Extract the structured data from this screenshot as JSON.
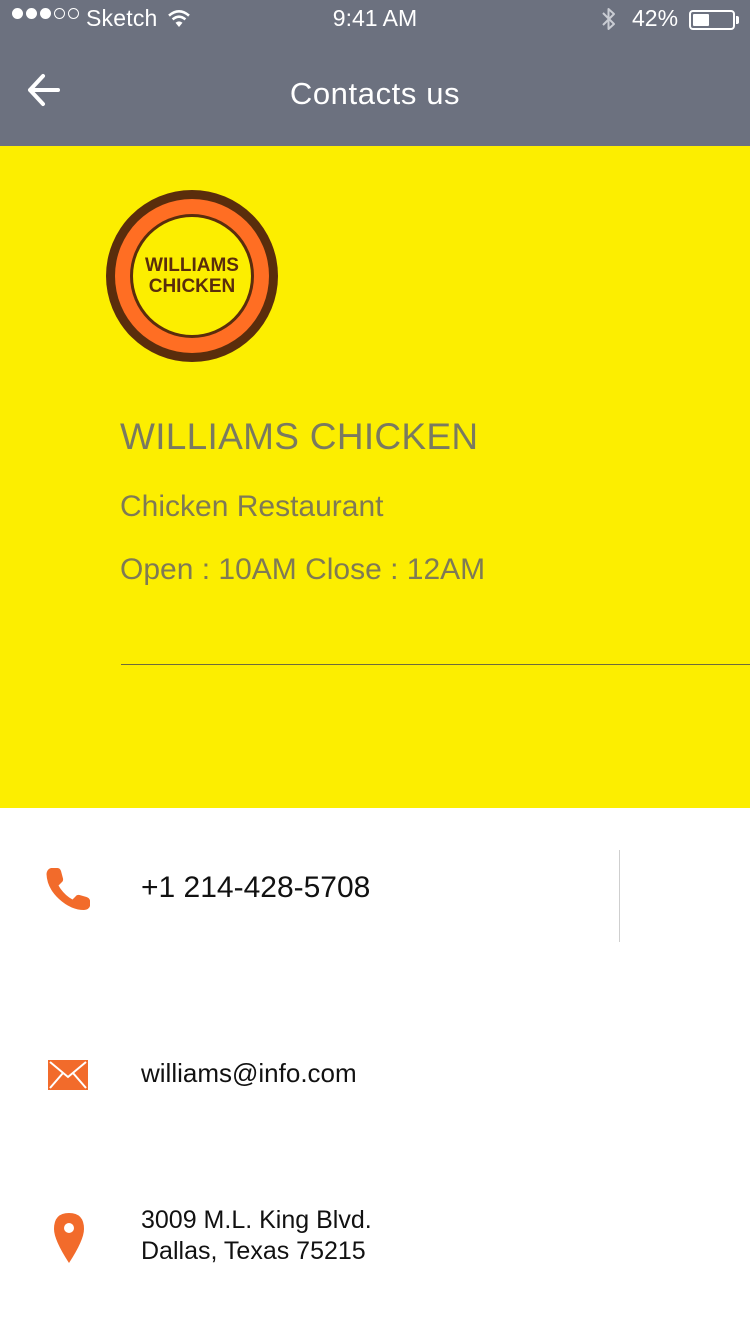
{
  "status_bar": {
    "carrier": "Sketch",
    "time": "9:41 AM",
    "battery": "42%",
    "battery_level": 0.42
  },
  "nav": {
    "title": "Contacts us",
    "back_icon": "arrow-left-icon"
  },
  "restaurant": {
    "logo_line1": "WILLIAMS",
    "logo_line2": "CHICKEN",
    "name": "WILLIAMS CHICKEN",
    "type": "Chicken Restaurant",
    "hours": "Open : 10AM Close : 12AM"
  },
  "contacts": {
    "phone": "+1 214-428-5708",
    "email": "williams@info.com",
    "address_line1": "3009 M.L. King Blvd.",
    "address_line2": "Dallas, Texas 75215"
  },
  "colors": {
    "nav_bg": "#6c717f",
    "hero_bg": "#fcee00",
    "accent": "#ff6e23",
    "logo_dark": "#5a2d0c"
  },
  "icons": [
    "phone-icon",
    "mail-icon",
    "location-pin-icon"
  ]
}
